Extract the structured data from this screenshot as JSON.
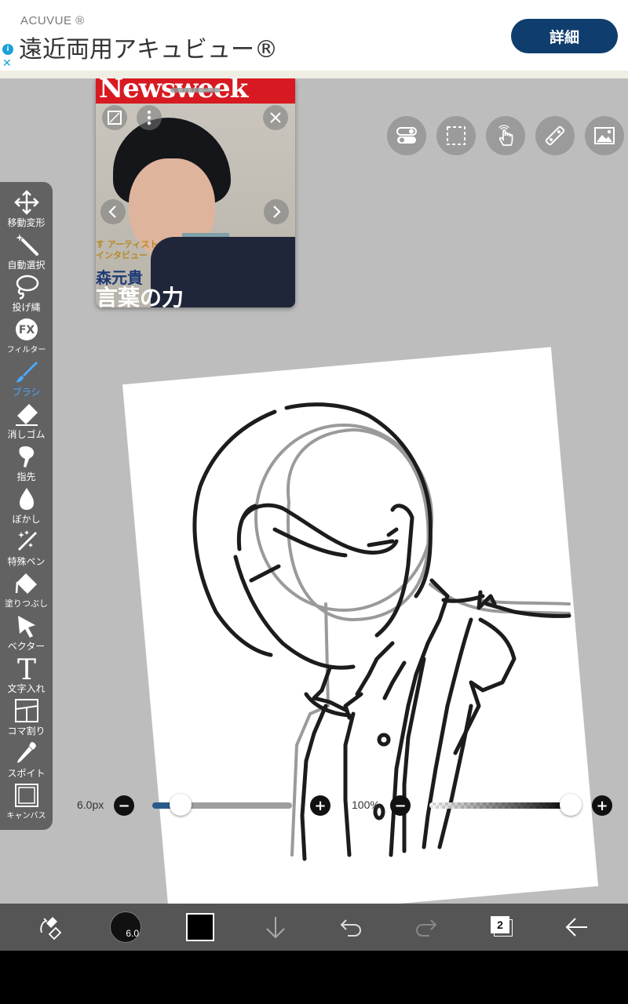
{
  "ad": {
    "brand": "ACUVUE ®",
    "title": "遠近両用アキュビュー®",
    "cta": "詳細",
    "info_glyph": "i",
    "close_glyph": "✕"
  },
  "reference": {
    "banner": "Newsweek",
    "small_text": "す アーティスト\nインタビュー",
    "name_text": "森元貴",
    "big_text": "言葉の力"
  },
  "tools": [
    {
      "label": "移動変形",
      "icon": "move-icon"
    },
    {
      "label": "自動選択",
      "icon": "magic-wand-icon"
    },
    {
      "label": "投げ縄",
      "icon": "lasso-icon"
    },
    {
      "label": "フィルター",
      "icon": "fx-icon"
    },
    {
      "label": "ブラシ",
      "icon": "brush-icon",
      "active": true
    },
    {
      "label": "消しゴム",
      "icon": "eraser-icon"
    },
    {
      "label": "指先",
      "icon": "finger-icon"
    },
    {
      "label": "ぼかし",
      "icon": "blur-icon"
    },
    {
      "label": "特殊ペン",
      "icon": "special-pen-icon"
    },
    {
      "label": "塗りつぶし",
      "icon": "fill-icon"
    },
    {
      "label": "ベクター",
      "icon": "vector-icon"
    },
    {
      "label": "文字入れ",
      "icon": "text-icon"
    },
    {
      "label": "コマ割り",
      "icon": "panel-icon"
    },
    {
      "label": "スポイト",
      "icon": "eyedropper-icon"
    },
    {
      "label": "キャンバス",
      "icon": "canvas-icon"
    }
  ],
  "fx_glyph": "FX",
  "text_glyph": "T",
  "brush": {
    "size_label": "6.0px",
    "size_fraction": 0.2,
    "opacity_label": "100%",
    "opacity_fraction": 1.0,
    "size_badge": "6.0"
  },
  "minus_glyph": "−",
  "plus_glyph": "+",
  "layers_count": "2",
  "colors": {
    "accent": "#4aa8ff",
    "ad_button": "#0f3e6e",
    "toolbar": "#626262",
    "workspace": "#bdbdbd",
    "bottom_bar": "#555555",
    "current_color": "#000000"
  }
}
